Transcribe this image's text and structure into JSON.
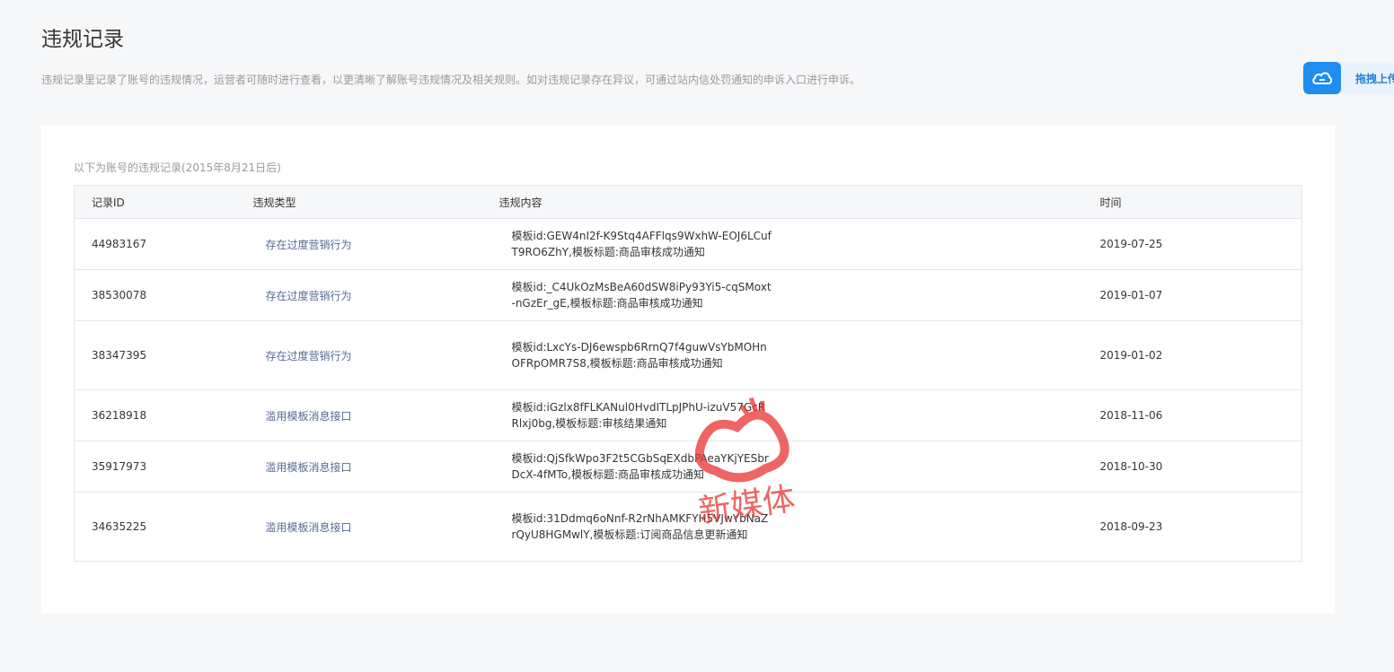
{
  "page": {
    "title": "违规记录",
    "description": "违规记录里记录了账号的违规情况，运营者可随时进行查看，以更清晰了解账号违规情况及相关规则。如对违规记录存在异议，可通过站内信处罚通知的申诉入口进行申诉。"
  },
  "upload_widget": {
    "icon": "cloud-upload-icon",
    "label": "拖拽上传"
  },
  "table": {
    "caption": "以下为账号的违规记录(2015年8月21日后)",
    "columns": {
      "id": "记录ID",
      "type": "违规类型",
      "content": "违规内容",
      "time": "时间"
    },
    "rows": [
      {
        "id": "44983167",
        "type": "存在过度营销行为",
        "content": "模板id:GEW4nI2f-K9Stq4AFFlqs9WxhW-EOJ6LCufT9RO6ZhY,模板标题:商品审核成功通知",
        "time": "2019-07-25"
      },
      {
        "id": "38530078",
        "type": "存在过度营销行为",
        "content": "模板id:_C4UkOzMsBeA60dSW8iPy93Yi5-cqSMoxt-nGzEr_gE,模板标题:商品审核成功通知",
        "time": "2019-01-07"
      },
      {
        "id": "38347395",
        "type": "存在过度营销行为",
        "content": "模板id:LxcYs-DJ6ewspb6RrnQ7f4guwVsYbMOHnOFRpOMR7S8,模板标题:商品审核成功通知",
        "time": "2019-01-02"
      },
      {
        "id": "36218918",
        "type": "滥用模板消息接口",
        "content": "模板id:iGzlx8fFLKANul0HvdITLpJPhU-izuV57GcRRlxj0bg,模板标题:审核结果通知",
        "time": "2018-11-06"
      },
      {
        "id": "35917973",
        "type": "滥用模板消息接口",
        "content": "模板id:QjSfkWpo3F2t5CGbSqEXdbPAeaYKjYESbrDcX-4fMTo,模板标题:商品审核成功通知",
        "time": "2018-10-30"
      },
      {
        "id": "34635225",
        "type": "滥用模板消息接口",
        "content": "模板id:31Ddmq6oNnf-R2rNhAMKFYH5VJwYbNaZrQyU8HGMwlY,模板标题:订阅商品信息更新通知",
        "time": "2018-09-23"
      }
    ]
  },
  "watermark": {
    "text": "新媒体",
    "color": "#e8332f"
  }
}
